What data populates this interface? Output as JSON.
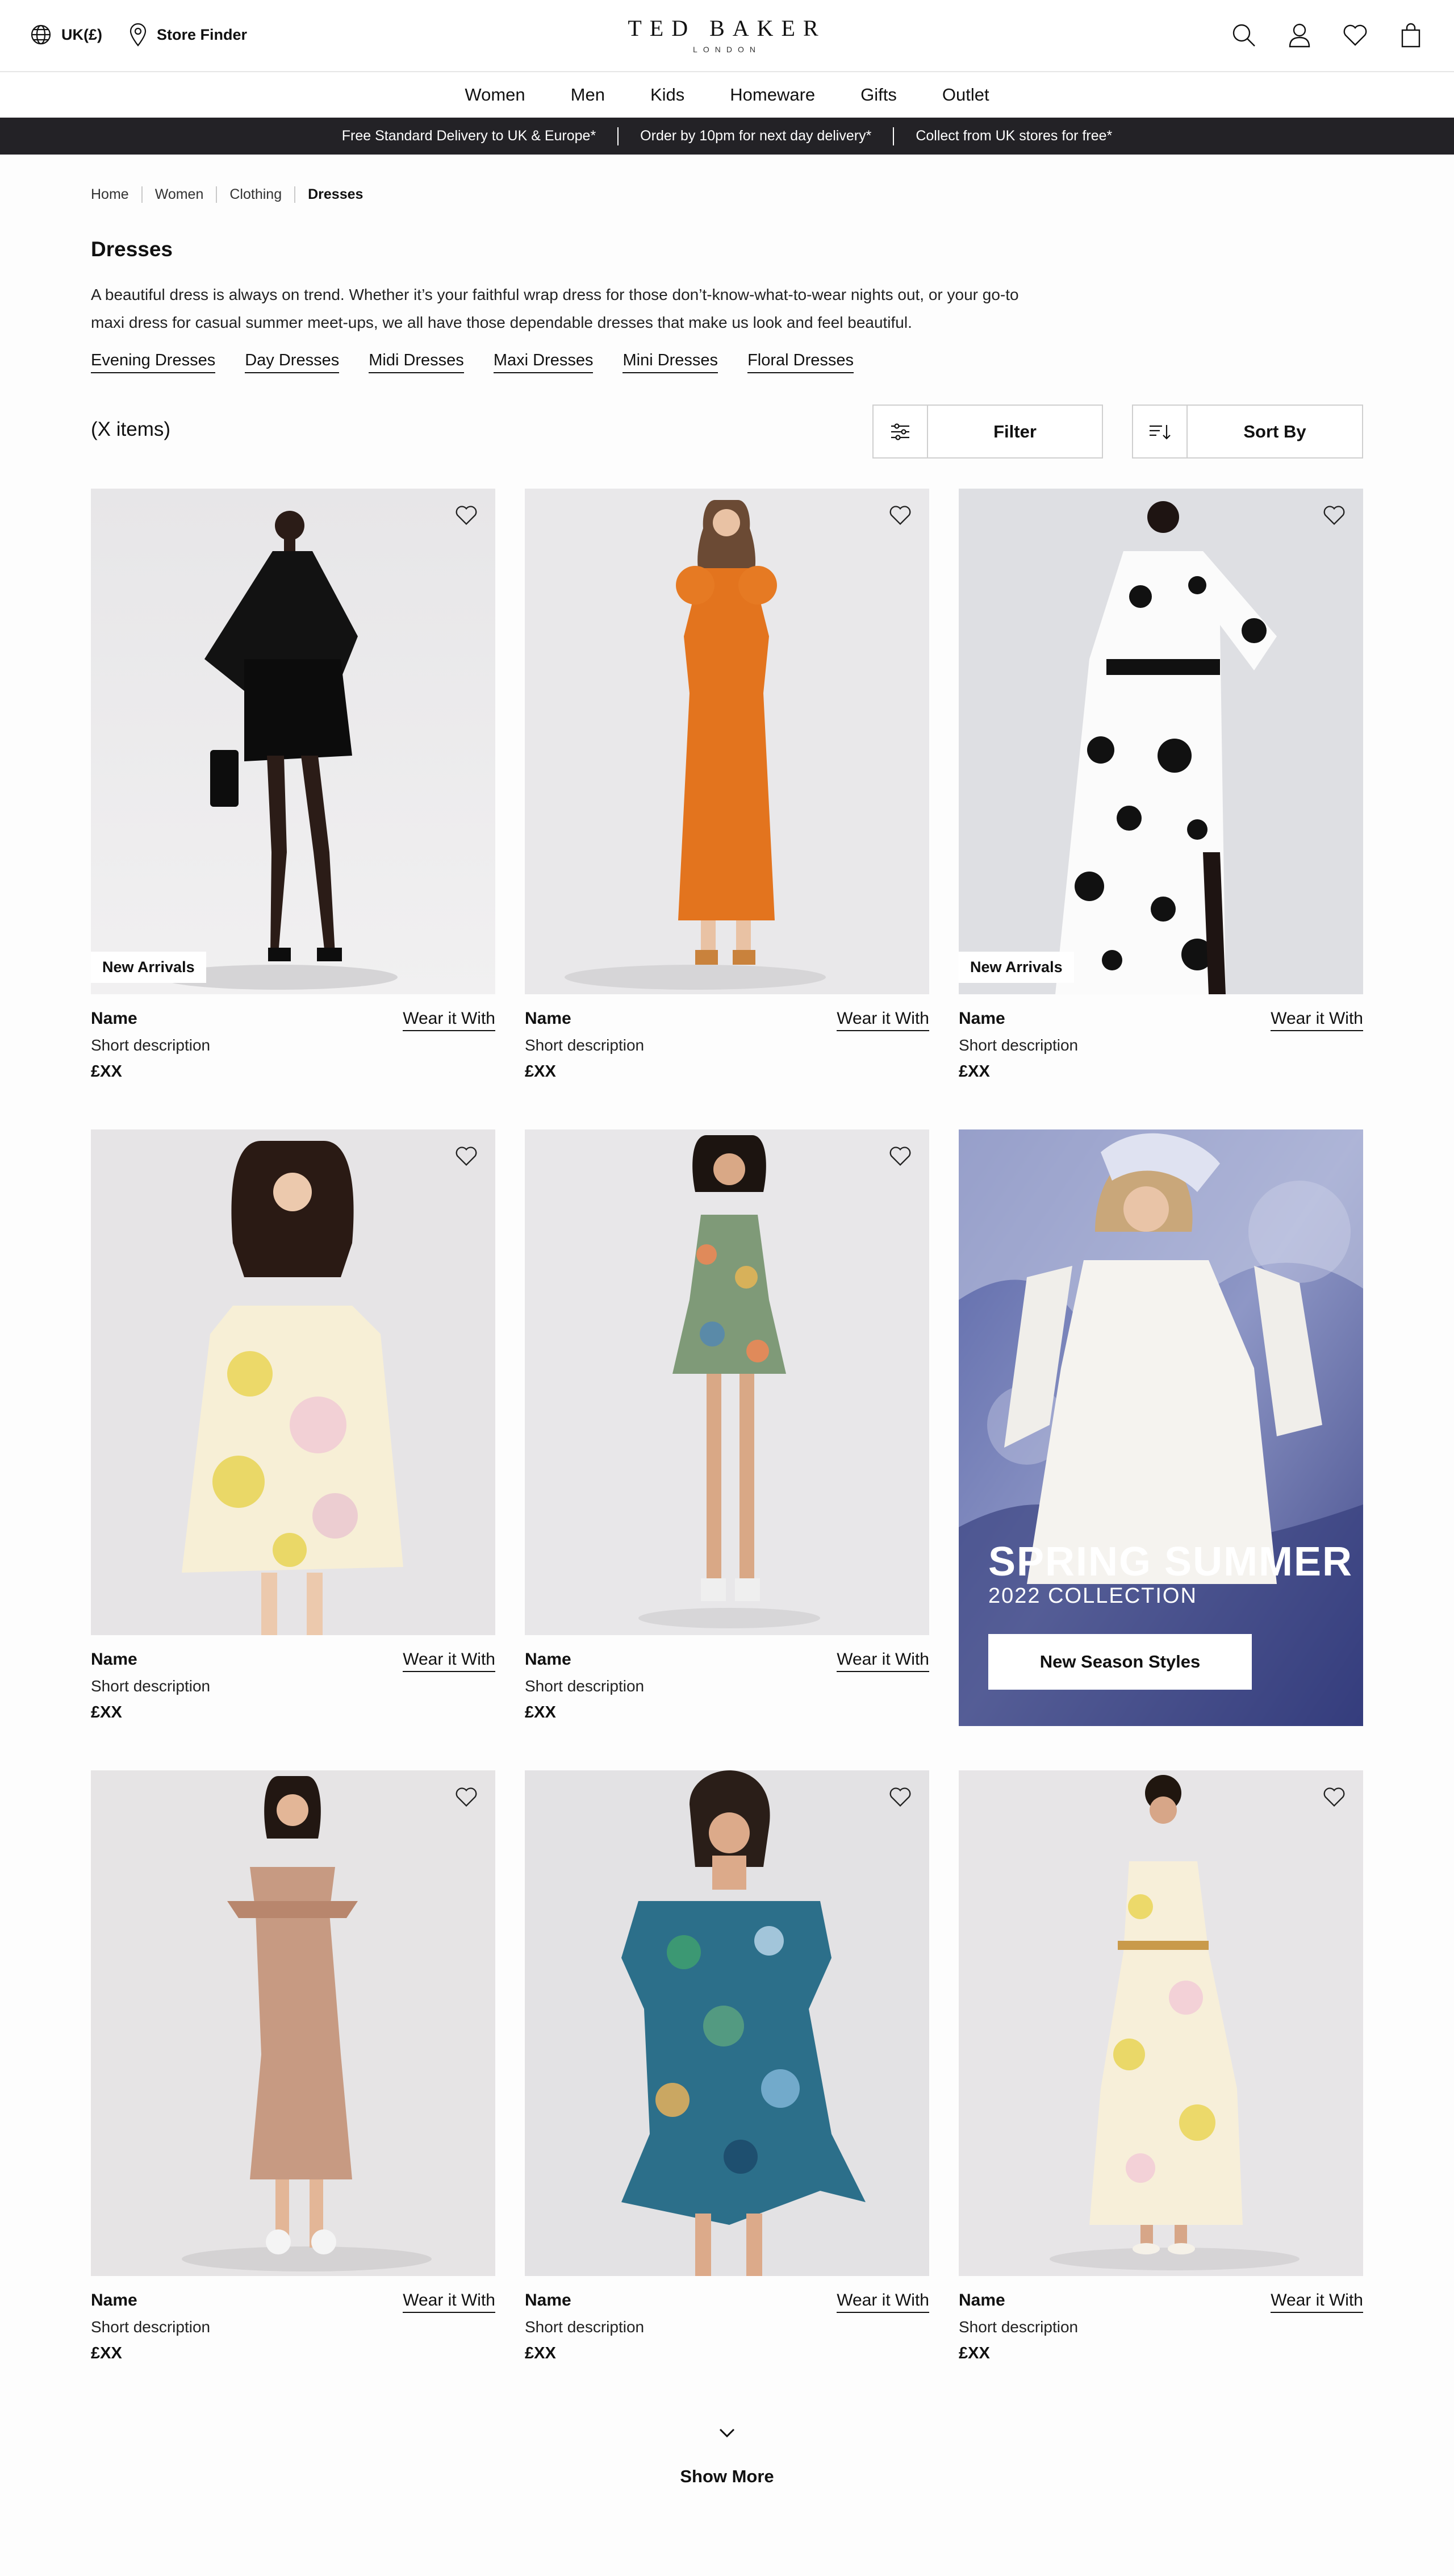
{
  "header": {
    "region": "UK(£)",
    "store_finder": "Store Finder",
    "logo": "TED BAKER",
    "logo_sub": "LONDON"
  },
  "nav": [
    "Women",
    "Men",
    "Kids",
    "Homeware",
    "Gifts",
    "Outlet"
  ],
  "promo_bar": [
    "Free Standard Delivery to UK & Europe*",
    "Order by 10pm for next day delivery*",
    "Collect from UK stores for free*"
  ],
  "breadcrumb": [
    "Home",
    "Women",
    "Clothing",
    "Dresses"
  ],
  "page": {
    "title": "Dresses",
    "intro_line1": "A beautiful dress is always on trend. Whether it’s your faithful wrap dress for those don’t-know-what-to-wear nights out, or your go-to",
    "intro_line2": "maxi dress for casual summer meet-ups, we all have those dependable dresses that make us look and feel beautiful.",
    "subcategories": [
      "Evening Dresses",
      "Day Dresses",
      "Midi Dresses",
      "Maxi Dresses",
      "Mini Dresses",
      "Floral Dresses"
    ],
    "count": "(X items)"
  },
  "controls": {
    "filter": "Filter",
    "sort": "Sort By"
  },
  "products": [
    {
      "name": "Name",
      "wear": "Wear it With",
      "desc": "Short description",
      "price": "£XX",
      "badge": "New Arrivals"
    },
    {
      "name": "Name",
      "wear": "Wear it With",
      "desc": "Short description",
      "price": "£XX",
      "badge": ""
    },
    {
      "name": "Name",
      "wear": "Wear it With",
      "desc": "Short description",
      "price": "£XX",
      "badge": "New Arrivals"
    },
    {
      "name": "Name",
      "wear": "Wear it With",
      "desc": "Short description",
      "price": "£XX",
      "badge": ""
    },
    {
      "name": "Name",
      "wear": "Wear it With",
      "desc": "Short description",
      "price": "£XX",
      "badge": ""
    },
    {
      "name": "Name",
      "wear": "Wear it With",
      "desc": "Short description",
      "price": "£XX",
      "badge": ""
    },
    {
      "name": "Name",
      "wear": "Wear it With",
      "desc": "Short description",
      "price": "£XX",
      "badge": ""
    },
    {
      "name": "Name",
      "wear": "Wear it With",
      "desc": "Short description",
      "price": "£XX",
      "badge": ""
    }
  ],
  "campaign": {
    "headline": "SPRING SUMMER",
    "subline": "2022 COLLECTION",
    "cta": "New Season Styles"
  },
  "show_more": "Show More",
  "icons": {
    "region": "globe-icon",
    "store": "location-pin-icon",
    "search": "search-icon",
    "account": "user-icon",
    "wishlist": "heart-icon",
    "bag": "shopping-bag-icon",
    "filter": "filter-sliders-icon",
    "sort": "sort-icon",
    "show_more": "chevron-down-icon"
  },
  "colors": {
    "promo_bar_bg": "#232226",
    "accent": "#111111"
  }
}
